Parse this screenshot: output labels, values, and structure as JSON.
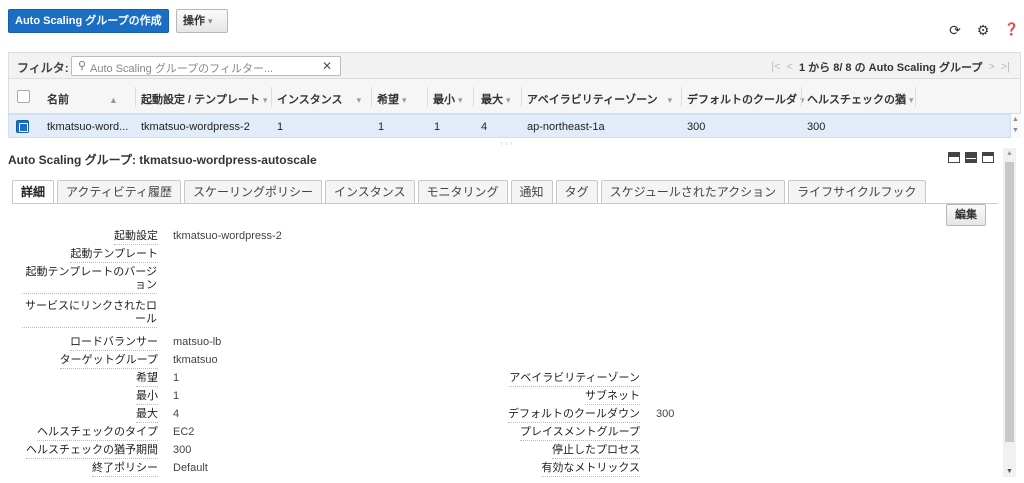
{
  "toolbar": {
    "create_label": "Auto Scaling グループの作成",
    "actions_label": "操作",
    "actions_caret": "▾"
  },
  "filter": {
    "label": "フィルタ:",
    "placeholder": "Auto Scaling グループのフィルター...",
    "clear": "✕"
  },
  "pager": {
    "first": "|<",
    "prev": "<",
    "text": "1 から 8/ 8 の Auto Scaling グループ",
    "next": ">",
    "last": ">|"
  },
  "columns": {
    "name": "名前",
    "launch": "起動設定 / テンプレート",
    "instances": "インスタンス",
    "desired": "希望",
    "min": "最小",
    "max": "最大",
    "az": "アベイラビリティーゾーン",
    "cooldown": "デフォルトのクールダ",
    "health": "ヘルスチェックの猶"
  },
  "row": {
    "name": "tkmatsuo-word...",
    "launch": "tkmatsuo-wordpress-2",
    "instances": "1",
    "desired": "1",
    "min": "1",
    "max": "4",
    "az": "ap-northeast-1a",
    "cooldown": "300",
    "health": "300"
  },
  "resize_handle": "◦◦◦",
  "detail": {
    "title": "Auto Scaling グループ: tkmatsuo-wordpress-autoscale",
    "edit_label": "編集",
    "tabs": [
      "詳細",
      "アクティビティ履歴",
      "スケーリングポリシー",
      "インスタンス",
      "モニタリング",
      "通知",
      "タグ",
      "スケジュールされたアクション",
      "ライフサイクルフック"
    ],
    "left": {
      "launch_config_label": "起動設定",
      "launch_config_value": "tkmatsuo-wordpress-2",
      "launch_template_label": "起動テンプレート",
      "template_version_label": "起動テンプレートのバージョン",
      "service_role_label": "サービスにリンクされたロール",
      "load_balancer_label": "ロードバランサー",
      "load_balancer_value": "matsuo-lb",
      "target_group_label": "ターゲットグループ",
      "target_group_value": "tkmatsuo",
      "desired_label": "希望",
      "desired_value": "1",
      "min_label": "最小",
      "min_value": "1",
      "max_label": "最大",
      "max_value": "4",
      "health_type_label": "ヘルスチェックのタイプ",
      "health_type_value": "EC2",
      "grace_label": "ヘルスチェックの猶予期間",
      "grace_value": "300",
      "termination_label": "終了ポリシー",
      "termination_value": "Default"
    },
    "right": {
      "az_label": "アベイラビリティーゾーン",
      "subnet_label": "サブネット",
      "cooldown_label": "デフォルトのクールダウン",
      "cooldown_value": "300",
      "placement_label": "プレイスメントグループ",
      "suspended_label": "停止したプロセス",
      "metrics_label": "有効なメトリックス"
    }
  },
  "icons": {
    "refresh": "⟳",
    "settings": "⚙",
    "help": "❓"
  }
}
